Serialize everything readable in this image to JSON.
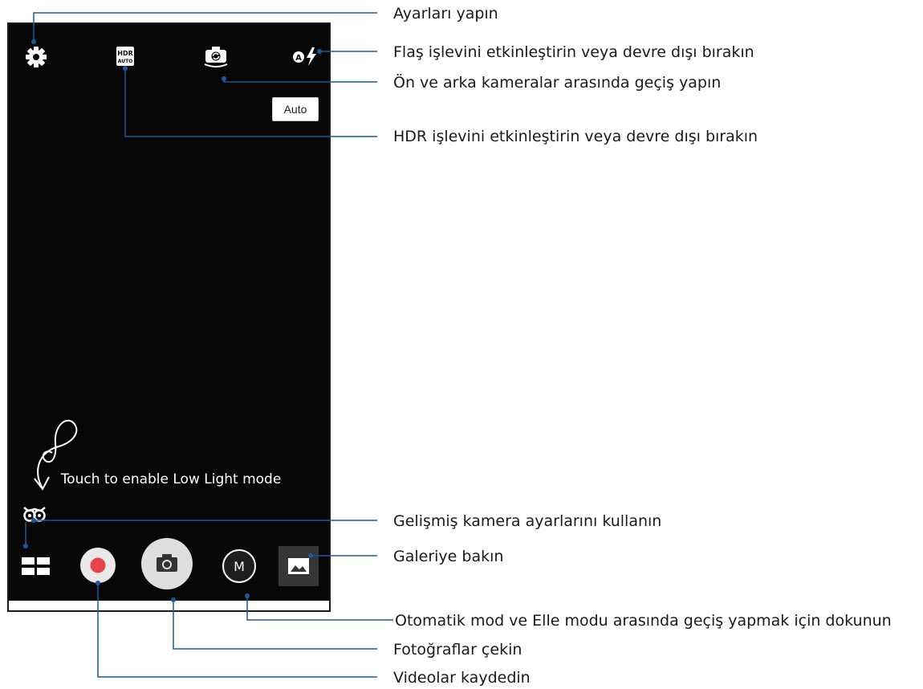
{
  "camera": {
    "auto_button_label": "Auto",
    "low_light_hint": "Touch to enable Low Light mode",
    "manual_mode_letter": "M",
    "icons": {
      "settings": "gear-icon",
      "hdr": "hdr-auto-icon",
      "camera_switch": "camera-switch-icon",
      "flash": "flash-auto-icon",
      "low_light": "owl-icon",
      "modes": "grid-icon",
      "record": "record-icon",
      "shutter": "camera-icon",
      "manual": "manual-mode-icon",
      "gallery": "gallery-icon"
    },
    "hdr_text_top": "HDR",
    "hdr_text_bottom": "AUTO",
    "flash_badge": "A"
  },
  "callouts": {
    "settings": "Ayarları yapın",
    "flash": "Flaş işlevini etkinleştirin veya devre dışı bırakın",
    "camera_switch": "Ön ve arka kameralar arasında geçiş yapın",
    "hdr": "HDR işlevini etkinleştirin veya devre dışı bırakın",
    "advanced": "Gelişmiş kamera ayarlarını kullanın",
    "gallery": "Galeriye bakın",
    "mode_toggle": "Otomatik mod ve Elle modu arasında geçiş yapmak için dokunun",
    "photo": "Fotoğraflar çekin",
    "video": "Videolar kaydedin"
  },
  "colors": {
    "leader_line": "#1b5a96",
    "record_red": "#e8434a",
    "preview_bg": "#070606"
  }
}
